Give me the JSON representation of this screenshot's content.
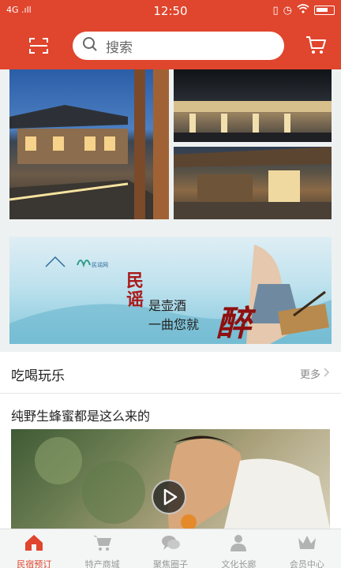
{
  "status_bar": {
    "network": "4G .ıll",
    "time": "12:50"
  },
  "header": {
    "search_placeholder": "搜索",
    "scan_icon": "scan-icon",
    "cart_icon": "cart-icon"
  },
  "banner": {
    "line1": "民",
    "line1b": "谣",
    "line2": "是壶酒",
    "line3": "一曲您就",
    "emphasis": "醉",
    "logo_caption": "民谣网"
  },
  "section": {
    "title": "吃喝玩乐",
    "more_label": "更多",
    "article_title": "纯野生蜂蜜都是这么来的"
  },
  "tabbar": {
    "items": [
      {
        "label": "民宿预订",
        "icon": "house-icon",
        "active": true
      },
      {
        "label": "特产商城",
        "icon": "cart-icon",
        "active": false
      },
      {
        "label": "聚焦圈子",
        "icon": "chat-bubble-icon",
        "active": false
      },
      {
        "label": "文化长廊",
        "icon": "person-icon",
        "active": false
      },
      {
        "label": "会员中心",
        "icon": "crown-icon",
        "active": false
      }
    ]
  },
  "colors": {
    "brand_red": "#e0452d",
    "inactive_gray": "#999999"
  }
}
